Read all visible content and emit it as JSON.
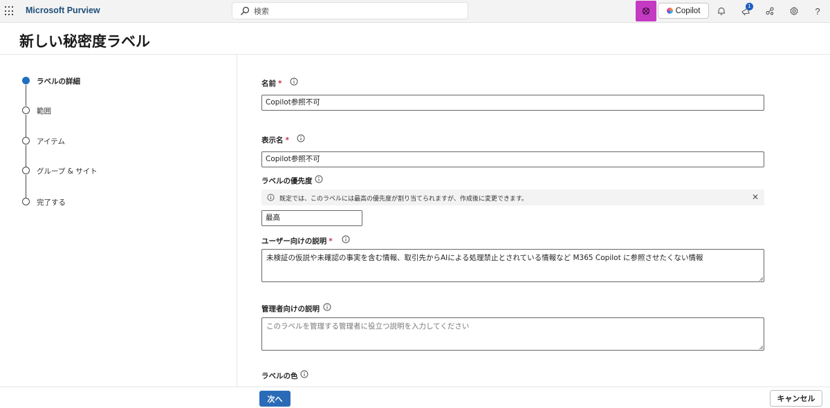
{
  "topbar": {
    "app_title": "Microsoft Purview",
    "search_placeholder": "検索",
    "copilot_label": "Copilot",
    "notification_count": "1",
    "accent_color": "#c43ac2"
  },
  "page": {
    "title": "新しい秘密度ラベル"
  },
  "stepper": {
    "steps": [
      {
        "label": "ラベルの詳細",
        "active": true
      },
      {
        "label": "範囲",
        "active": false
      },
      {
        "label": "アイテム",
        "active": false
      },
      {
        "label": "グループ & サイト",
        "active": false
      },
      {
        "label": "完了する",
        "active": false
      }
    ]
  },
  "form": {
    "name": {
      "label": "名前",
      "required_mark": "*",
      "value": "Copilot参照不可"
    },
    "display_name": {
      "label": "表示名",
      "required_mark": "*",
      "value": "Copilot参照不可"
    },
    "priority": {
      "label": "ラベルの優先度",
      "notice": "既定では、このラベルには最高の優先度が割り当てられますが、作成後に変更できます。",
      "value": "最高"
    },
    "user_description": {
      "label": "ユーザー向けの説明",
      "required_mark": "*",
      "value": "未検証の仮説や未確認の事実を含む情報、取引先からAIによる処理禁止とされている情報など M365 Copilot に参照させたくない情報"
    },
    "admin_description": {
      "label": "管理者向けの説明",
      "placeholder": "このラベルを管理する管理者に役立つ説明を入力してください"
    },
    "label_color": {
      "label": "ラベルの色"
    }
  },
  "footer": {
    "next_label": "次へ",
    "cancel_label": "キャンセル"
  }
}
